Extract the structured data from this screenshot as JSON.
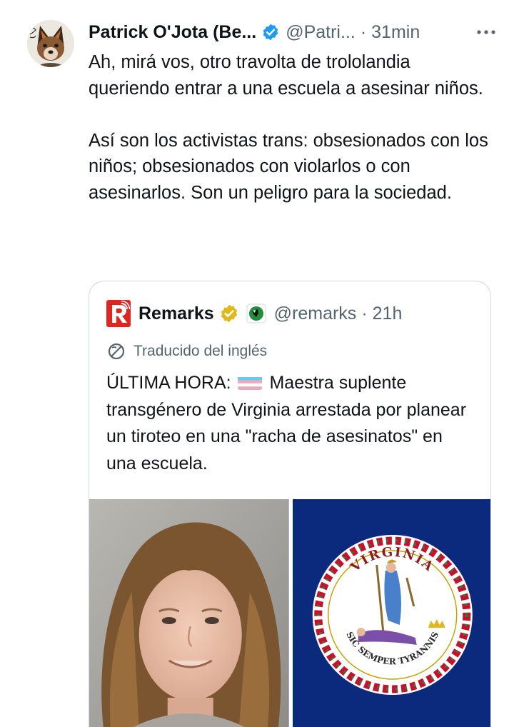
{
  "tweet": {
    "author": {
      "display_name": "Patrick O'Jota (Be...",
      "handle": "@Patri...",
      "avatar_icon": "wolf-avatar-icon"
    },
    "separator": "·",
    "time": "31min",
    "text": "Ah, mirá vos, otro travolta de trololandia queriendo entrar a una escuela a asesinar niños.\n\nAsí son los activistas trans: obsesionados con los niños; obsesionados con violarlos o con asesinarlos. Son un peligro para la sociedad."
  },
  "quote": {
    "author": {
      "display_name": "Remarks",
      "handle": "@remarks",
      "logo_icon": "remarks-logo-icon",
      "badge_icon": "gold-verified-badge-icon",
      "affiliate_icon": "affiliate-badge-icon"
    },
    "separator": "·",
    "time": "21h",
    "translated_label": "Traducido del inglés",
    "text_before": "ÚLTIMA HORA: ",
    "flag_icon": "transgender-flag-icon",
    "text_after": " Maestra suplente transgénero de Virginia arrestada por planear un tiroteo en una \"racha de asesinatos\" en una escuela.",
    "media": [
      {
        "kind": "photo",
        "icon": "mugshot-photo"
      },
      {
        "kind": "photo",
        "icon": "virginia-state-flag"
      }
    ],
    "seal_text_top": "VIRGINIA",
    "seal_text_bottom": "SIC SEMPER TYRANNIS"
  },
  "colors": {
    "text": "#0f1419",
    "secondary": "#536471",
    "border": "#cfd9de",
    "verified_blue": "#1d9bf0",
    "gold_badge": "#e2b719",
    "remarks_red": "#e0241f",
    "virginia_blue": "#0b2a7d"
  }
}
